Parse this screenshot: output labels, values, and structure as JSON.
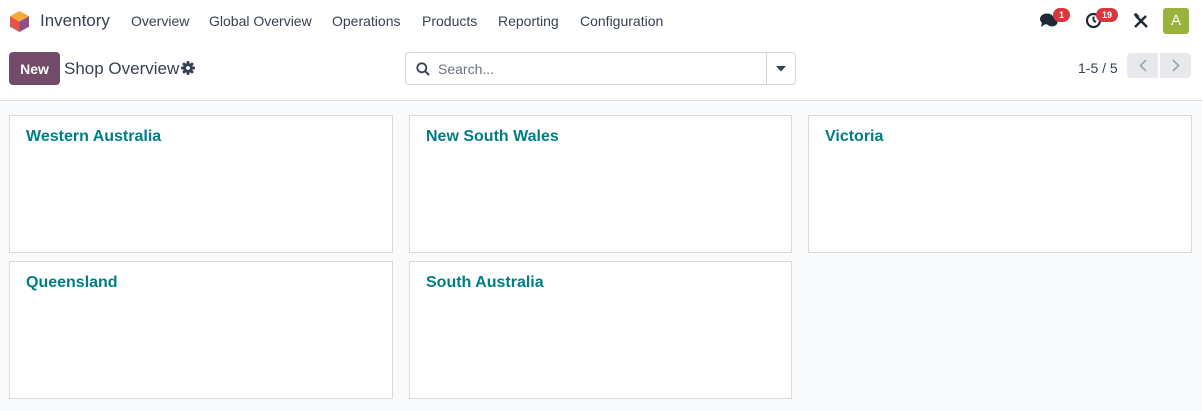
{
  "app": {
    "name": "Inventory",
    "brand_color": "#714b67",
    "accent_color": "#017e84"
  },
  "nav": {
    "items": [
      "Overview",
      "Global Overview",
      "Operations",
      "Products",
      "Reporting",
      "Configuration"
    ]
  },
  "systray": {
    "messages_icon": "chat-bubbles-icon",
    "messages_count": "1",
    "activities_icon": "clock-icon",
    "activities_count": "19",
    "debug_icon": "tools-icon",
    "avatar_letter": "A"
  },
  "control_panel": {
    "new_label": "New",
    "title": "Shop Overview",
    "settings_icon": "gear-icon"
  },
  "search": {
    "placeholder": "Search...",
    "value": ""
  },
  "pager": {
    "value": "1-5 / 5"
  },
  "cards": [
    {
      "title": "Western Australia"
    },
    {
      "title": "New South Wales"
    },
    {
      "title": "Victoria"
    },
    {
      "title": "Queensland"
    },
    {
      "title": "South Australia"
    }
  ]
}
